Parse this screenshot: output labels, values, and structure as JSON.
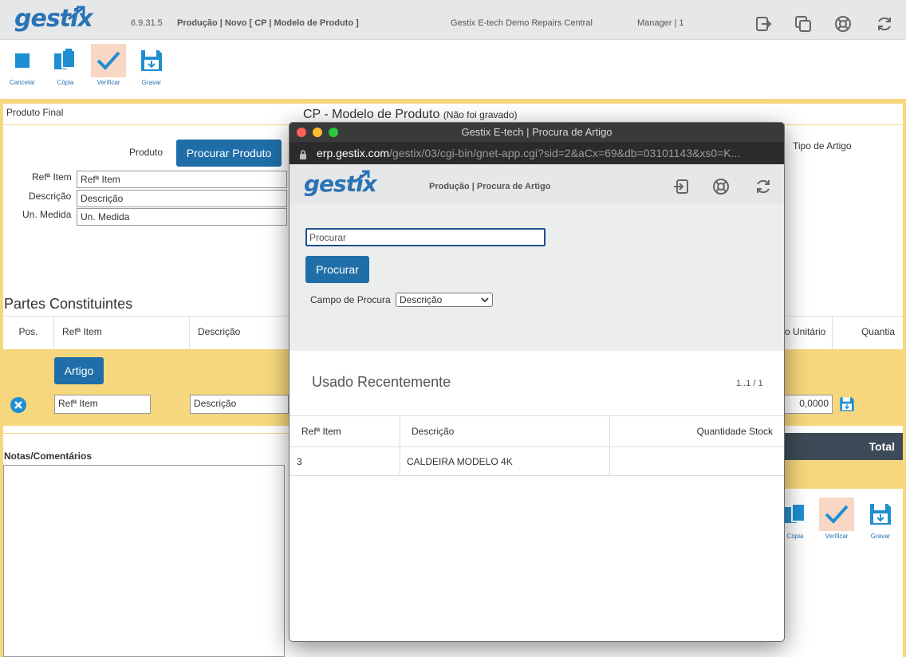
{
  "header": {
    "logo": "gestix",
    "version": "6.9.31.5",
    "title": "Produção | Novo [ CP | Modelo de Produto ]",
    "company": "Gestix E-tech Demo Repairs Central",
    "user": "Manager | 1",
    "icons": [
      "logout-icon",
      "windows-icon",
      "help-icon",
      "refresh-icon"
    ]
  },
  "toolbar": {
    "cancel": "Cancelar",
    "copy": "Cópia",
    "verify": "Verificar",
    "save": "Gravar"
  },
  "form": {
    "produto_final": "Produto Final",
    "heading": "CP - Modelo de Produto",
    "heading_note": "(Não foi gravado)",
    "produto_label": "Produto",
    "procurar_produto": "Procurar Produto",
    "ref_label": "Refª Item",
    "ref_placeholder": "Refª Item",
    "desc_label": "Descrição",
    "desc_placeholder": "Descrição",
    "un_label": "Un. Medida",
    "un_placeholder": "Un. Medida",
    "tipo_artigo": "Tipo de Artigo"
  },
  "parts": {
    "title": "Partes Constituintes",
    "col_pos": "Pos.",
    "col_ref": "Refª Item",
    "col_desc": "Descrição",
    "col_unit": "o Unitário",
    "col_qty": "Quantia",
    "artigo_button": "Artigo",
    "row_ref_placeholder": "Refª Item",
    "row_desc_placeholder": "Descrição",
    "row_qty": "0,0000",
    "total": "Total"
  },
  "notes": {
    "label": "Notas/Comentários"
  },
  "bottom_toolbar": {
    "copy": "Cópia",
    "verify": "Verificar",
    "save": "Gravar"
  },
  "modal": {
    "window_title": "Gestix E-tech | Procura de Artigo",
    "url_host": "erp.gestix.com",
    "url_path": "/gestix/03/cgi-bin/gnet-app.cgi?sid=2&aCx=69&db=03101143&xs0=K...",
    "logo": "gestix",
    "page_title": "Produção | Procura de Artigo",
    "search_placeholder": "Procurar",
    "search_button": "Procurar",
    "campo_label": "Campo de Procura",
    "campo_value": "Descrição",
    "recent_title": "Usado Recentemente",
    "pagination": "1..1 / 1",
    "table": {
      "headers": [
        "Refª Item",
        "Descrição",
        "Quantidade Stock"
      ],
      "rows": [
        {
          "ref": "3",
          "desc": "CALDEIRA MODELO 4K",
          "stock": ""
        }
      ]
    }
  },
  "colors": {
    "accent": "#1f6ea8",
    "frame": "#f7d77e",
    "dark_bar": "#3c4b57"
  }
}
